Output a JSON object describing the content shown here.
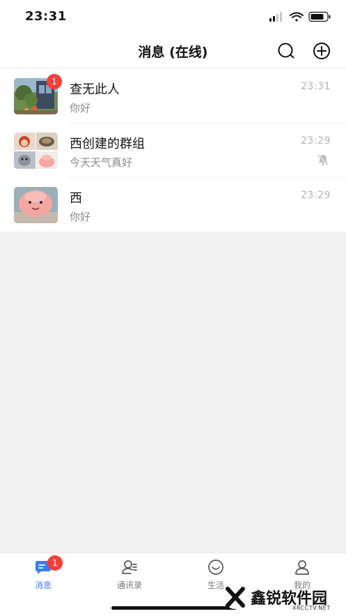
{
  "status_bar": {
    "time": "23:31"
  },
  "header": {
    "title": "消息 (在线)",
    "search_icon": "search-icon",
    "add_icon": "plus-circle-icon"
  },
  "conversations": [
    {
      "name": "查无此人",
      "preview": "你好",
      "time": "23:31",
      "unread": "1",
      "muted": false,
      "avatar": "photo-garden"
    },
    {
      "name": "西创建的群组",
      "preview": "今天天气真好",
      "time": "23:29",
      "unread": null,
      "muted": true,
      "avatar": "group-photo-grid"
    },
    {
      "name": "西",
      "preview": "你好",
      "time": "23:29",
      "unread": null,
      "muted": false,
      "avatar": "photo-pink-toy"
    }
  ],
  "tabbar": {
    "tabs": [
      {
        "label": "消息",
        "icon": "message-icon",
        "active": true,
        "badge": "1"
      },
      {
        "label": "通讯录",
        "icon": "contacts-icon",
        "active": false
      },
      {
        "label": "生活",
        "icon": "smile-icon",
        "active": false
      },
      {
        "label": "我的",
        "icon": "user-icon",
        "active": false
      }
    ]
  },
  "watermark": {
    "text": "鑫锐软件园",
    "sub": "XRCCTV.NET"
  },
  "colors": {
    "accent": "#3d7cf0",
    "badge": "#f0413b",
    "background": "#f2f2f2"
  }
}
